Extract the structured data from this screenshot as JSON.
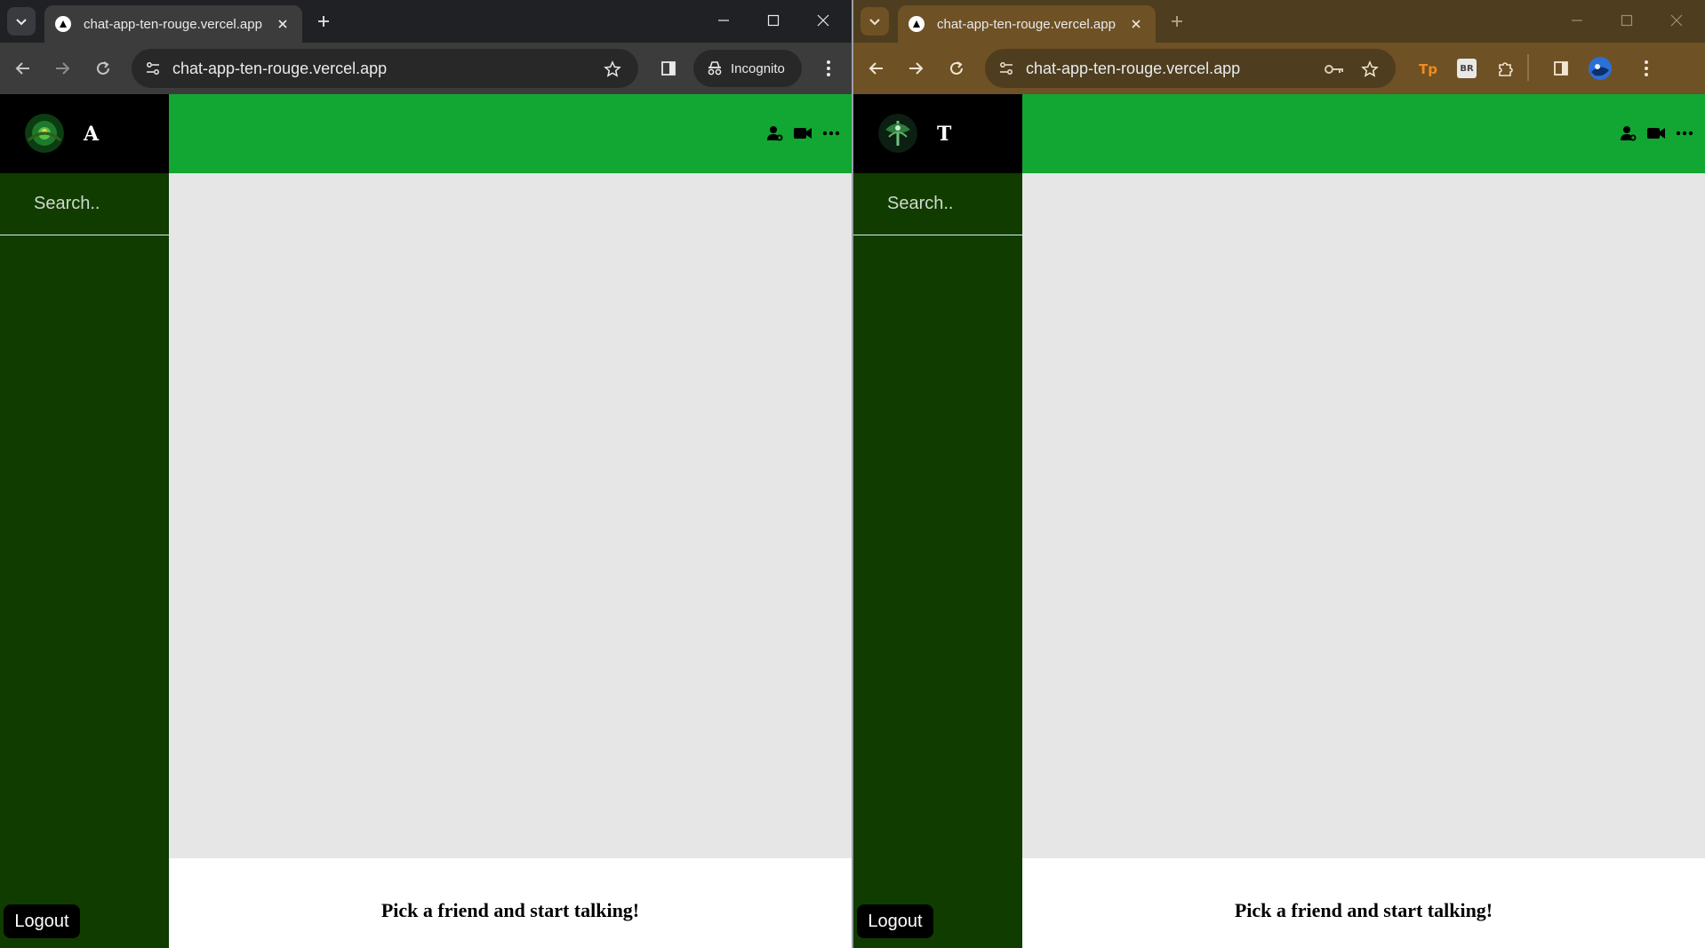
{
  "windows": {
    "left": {
      "tab_title": "chat-app-ten-rouge.vercel.app",
      "url": "chat-app-ten-rouge.vercel.app",
      "incognito_label": "Incognito",
      "user_initial": "A",
      "search_placeholder": "Search..",
      "logout_label": "Logout",
      "empty_message": "Pick a friend and start talking!"
    },
    "right": {
      "tab_title": "chat-app-ten-rouge.vercel.app",
      "url": "chat-app-ten-rouge.vercel.app",
      "extension_label": "BR",
      "user_initial": "T",
      "search_placeholder": "Search..",
      "logout_label": "Logout",
      "empty_message": "Pick a friend and start talking!"
    }
  },
  "icons": [
    "tab-search-icon",
    "favicon-icon",
    "tab-close-icon",
    "new-tab-icon",
    "minimize-icon",
    "maximize-icon",
    "window-close-icon",
    "back-icon",
    "forward-icon",
    "reload-icon",
    "site-info-icon",
    "bookmark-star-icon",
    "side-panel-icon",
    "incognito-icon",
    "browser-menu-icon",
    "key-icon",
    "extension-puzzle-icon",
    "add-user-icon",
    "video-call-icon",
    "more-options-icon"
  ],
  "colors": {
    "sidebar": "#103c00",
    "sidebar_header": "#000000",
    "chat_header": "#12a732",
    "chat_body": "#e6e6e6",
    "footer": "#ffffff"
  }
}
